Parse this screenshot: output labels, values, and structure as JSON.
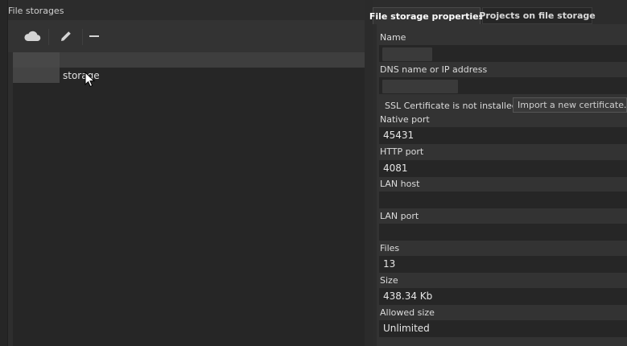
{
  "storages_panel": {
    "title": "File storages",
    "toolbar": {
      "cloud_icon": "cloud-icon",
      "edit_icon": "pencil-icon",
      "remove_icon": "minus-icon"
    },
    "items": [
      {
        "label": "storage"
      }
    ]
  },
  "tabs": [
    {
      "label": "File storage properties",
      "active": true
    },
    {
      "label": "Projects on file storage",
      "active": false
    }
  ],
  "properties": {
    "name": {
      "label": "Name",
      "value": ""
    },
    "dns": {
      "label": "DNS name or IP address",
      "value": ""
    },
    "ssl": {
      "status": "SSL Certificate is not installed",
      "import_button": "Import a new certificate..."
    },
    "native_port": {
      "label": "Native port",
      "value": "45431"
    },
    "http_port": {
      "label": "HTTP port",
      "value": "4081"
    },
    "lan_host": {
      "label": "LAN host",
      "value": ""
    },
    "lan_port": {
      "label": "LAN port",
      "value": ""
    },
    "files": {
      "label": "Files",
      "value": "13"
    },
    "size": {
      "label": "Size",
      "value": "438.34 Kb"
    },
    "allowed_size": {
      "label": "Allowed size",
      "value": "Unlimited"
    }
  },
  "colors": {
    "background": "#2c2c2c",
    "panel": "#333333",
    "field": "#262626",
    "text": "#dcdcdc"
  }
}
